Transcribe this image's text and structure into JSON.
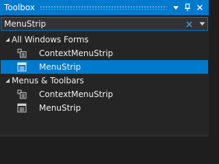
{
  "window": {
    "title": "Toolbox",
    "accent_color": "#007acc"
  },
  "title_buttons": [
    "dropdown-icon",
    "pin-icon",
    "close-icon"
  ],
  "search": {
    "value": "MenuStrip",
    "clear_icon": "close-icon",
    "dropdown_icon": "chevron-down-icon"
  },
  "tree": {
    "groups": [
      {
        "label": "All Windows Forms",
        "expanded": true,
        "items": [
          {
            "label": "ContextMenuStrip",
            "icon": "context-menu-strip-icon",
            "selected": false
          },
          {
            "label": "MenuStrip",
            "icon": "menu-strip-icon",
            "selected": true
          }
        ]
      },
      {
        "label": "Menus & Toolbars",
        "expanded": true,
        "items": [
          {
            "label": "ContextMenuStrip",
            "icon": "context-menu-strip-icon",
            "selected": false
          },
          {
            "label": "MenuStrip",
            "icon": "menu-strip-icon",
            "selected": false
          }
        ]
      }
    ]
  }
}
